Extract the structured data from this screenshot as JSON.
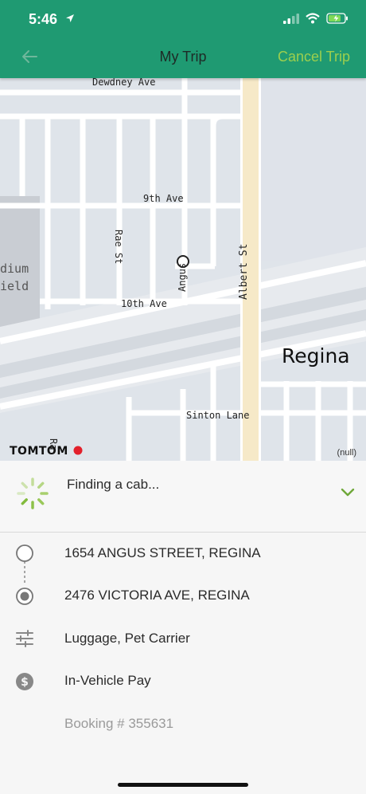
{
  "status_bar": {
    "time": "5:46"
  },
  "header": {
    "title": "My Trip",
    "cancel_label": "Cancel Trip"
  },
  "map": {
    "streets": {
      "dewdney": "Dewdney Ave",
      "ninth": "9th Ave",
      "tenth": "10th Ave",
      "rae": "Rae St",
      "angus": "Angus",
      "albert": "Albert St",
      "sinton": "Sinton Lane",
      "stadium_a": "dium",
      "stadium_b": "ield",
      "rae_b": "Ra"
    },
    "city": "Regina",
    "attribution": "TOMTOM",
    "null_label": "(null)"
  },
  "trip": {
    "status": "Finding a cab...",
    "pickup": "1654 ANGUS STREET, REGINA",
    "dropoff": "2476 VICTORIA AVE, REGINA",
    "extras": "Luggage, Pet Carrier",
    "payment": "In-Vehicle Pay",
    "booking": "Booking # 355631"
  },
  "colors": {
    "brand": "#1f9a72",
    "accent": "#9ccf4e"
  }
}
